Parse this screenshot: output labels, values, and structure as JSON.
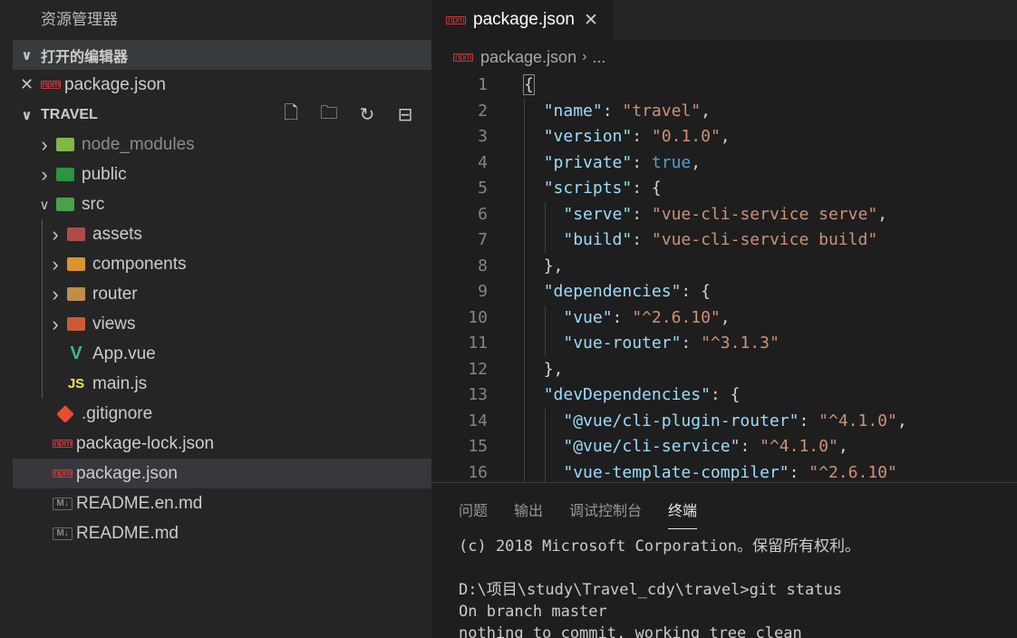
{
  "sidebar": {
    "title": "资源管理器",
    "open_editors": {
      "label": "打开的编辑器",
      "files": [
        {
          "name": "package.json",
          "icon": "npm-icon"
        }
      ]
    },
    "workspace": {
      "label": "TRAVEL",
      "actions": [
        "new-file-icon",
        "new-folder-icon",
        "refresh-icon",
        "collapse-all-icon"
      ]
    },
    "tree": [
      {
        "name": "node_modules",
        "kind": "folder",
        "depth": 0,
        "state": "collapsed",
        "icon": "node-folder-icon",
        "color": "#8cc84b"
      },
      {
        "name": "public",
        "kind": "folder",
        "depth": 0,
        "state": "collapsed",
        "icon": "public-folder-icon",
        "color": "#2ea043"
      },
      {
        "name": "src",
        "kind": "folder",
        "depth": 0,
        "state": "expanded",
        "icon": "src-folder-icon",
        "color": "#4caf50"
      },
      {
        "name": "assets",
        "kind": "folder",
        "depth": 1,
        "state": "collapsed",
        "icon": "assets-folder-icon",
        "color": "#c0504d"
      },
      {
        "name": "components",
        "kind": "folder",
        "depth": 1,
        "state": "collapsed",
        "icon": "components-folder-icon",
        "color": "#f0a030"
      },
      {
        "name": "router",
        "kind": "folder",
        "depth": 1,
        "state": "collapsed",
        "icon": "folder-icon",
        "color": "#d19a4a"
      },
      {
        "name": "views",
        "kind": "folder",
        "depth": 1,
        "state": "collapsed",
        "icon": "views-folder-icon",
        "color": "#e0603a"
      },
      {
        "name": "App.vue",
        "kind": "file",
        "depth": 1,
        "icon": "vue-icon",
        "color": "#41b883"
      },
      {
        "name": "main.js",
        "kind": "file",
        "depth": 1,
        "icon": "js-icon",
        "color": "#f1e05a"
      },
      {
        "name": ".gitignore",
        "kind": "file",
        "depth": 0,
        "icon": "git-icon",
        "color": "#e84d31"
      },
      {
        "name": "package-lock.json",
        "kind": "file",
        "depth": 0,
        "icon": "npm-icon",
        "color": "#cb3837"
      },
      {
        "name": "package.json",
        "kind": "file",
        "depth": 0,
        "icon": "npm-icon",
        "color": "#cb3837",
        "selected": true
      },
      {
        "name": "README.en.md",
        "kind": "file",
        "depth": 0,
        "icon": "markdown-icon",
        "color": "#8a8a8a"
      },
      {
        "name": "README.md",
        "kind": "file",
        "depth": 0,
        "icon": "markdown-icon",
        "color": "#8a8a8a"
      }
    ]
  },
  "editor": {
    "tab": {
      "label": "package.json",
      "icon_text": "npm"
    },
    "breadcrumb": {
      "file": "package.json",
      "more": "..."
    },
    "lines": [
      {
        "n": "1",
        "indent": 0,
        "parts": [
          [
            "p",
            "{"
          ]
        ]
      },
      {
        "n": "2",
        "indent": 1,
        "parts": [
          [
            "k",
            "\"name\""
          ],
          [
            "p",
            ": "
          ],
          [
            "s",
            "\"travel\""
          ],
          [
            "p",
            ","
          ]
        ]
      },
      {
        "n": "3",
        "indent": 1,
        "parts": [
          [
            "k",
            "\"version\""
          ],
          [
            "p",
            ": "
          ],
          [
            "s",
            "\"0.1.0\""
          ],
          [
            "p",
            ","
          ]
        ]
      },
      {
        "n": "4",
        "indent": 1,
        "parts": [
          [
            "k",
            "\"private\""
          ],
          [
            "p",
            ": "
          ],
          [
            "b",
            "true"
          ],
          [
            "p",
            ","
          ]
        ]
      },
      {
        "n": "5",
        "indent": 1,
        "parts": [
          [
            "k",
            "\"scripts\""
          ],
          [
            "p",
            ": {"
          ]
        ]
      },
      {
        "n": "6",
        "indent": 2,
        "parts": [
          [
            "k",
            "\"serve\""
          ],
          [
            "p",
            ": "
          ],
          [
            "s",
            "\"vue-cli-service serve\""
          ],
          [
            "p",
            ","
          ]
        ]
      },
      {
        "n": "7",
        "indent": 2,
        "parts": [
          [
            "k",
            "\"build\""
          ],
          [
            "p",
            ": "
          ],
          [
            "s",
            "\"vue-cli-service build\""
          ]
        ]
      },
      {
        "n": "8",
        "indent": 1,
        "parts": [
          [
            "p",
            "},"
          ]
        ]
      },
      {
        "n": "9",
        "indent": 1,
        "parts": [
          [
            "k",
            "\"dependencies\""
          ],
          [
            "p",
            ": {"
          ]
        ]
      },
      {
        "n": "10",
        "indent": 2,
        "parts": [
          [
            "k",
            "\"vue\""
          ],
          [
            "p",
            ": "
          ],
          [
            "s",
            "\"^2.6.10\""
          ],
          [
            "p",
            ","
          ]
        ]
      },
      {
        "n": "11",
        "indent": 2,
        "parts": [
          [
            "k",
            "\"vue-router\""
          ],
          [
            "p",
            ": "
          ],
          [
            "s",
            "\"^3.1.3\""
          ]
        ]
      },
      {
        "n": "12",
        "indent": 1,
        "parts": [
          [
            "p",
            "},"
          ]
        ]
      },
      {
        "n": "13",
        "indent": 1,
        "parts": [
          [
            "k",
            "\"devDependencies\""
          ],
          [
            "p",
            ": {"
          ]
        ]
      },
      {
        "n": "14",
        "indent": 2,
        "parts": [
          [
            "k",
            "\"@vue/cli-plugin-router\""
          ],
          [
            "p",
            ": "
          ],
          [
            "s",
            "\"^4.1.0\""
          ],
          [
            "p",
            ","
          ]
        ]
      },
      {
        "n": "15",
        "indent": 2,
        "parts": [
          [
            "k",
            "\"@vue/cli-service\""
          ],
          [
            "p",
            ": "
          ],
          [
            "s",
            "\"^4.1.0\""
          ],
          [
            "p",
            ","
          ]
        ]
      },
      {
        "n": "16",
        "indent": 2,
        "parts": [
          [
            "k",
            "\"vue-template-compiler\""
          ],
          [
            "p",
            ": "
          ],
          [
            "s",
            "\"^2.6.10\""
          ]
        ]
      }
    ]
  },
  "panel": {
    "tabs": [
      {
        "label": "问题",
        "active": false
      },
      {
        "label": "输出",
        "active": false
      },
      {
        "label": "调试控制台",
        "active": false
      },
      {
        "label": "终端",
        "active": true
      }
    ],
    "terminal_lines": [
      "(c) 2018 Microsoft Corporation。保留所有权利。",
      "",
      "D:\\项目\\study\\Travel_cdy\\travel>git status",
      "On branch master",
      "nothing to commit, working tree clean"
    ]
  },
  "colors": {
    "sidebar_bg": "#252526",
    "editor_bg": "#1e1e1e",
    "json_key": "#9cdcfe",
    "json_string": "#ce9178",
    "json_keyword": "#569cd6",
    "npm_red": "#cb3837"
  }
}
